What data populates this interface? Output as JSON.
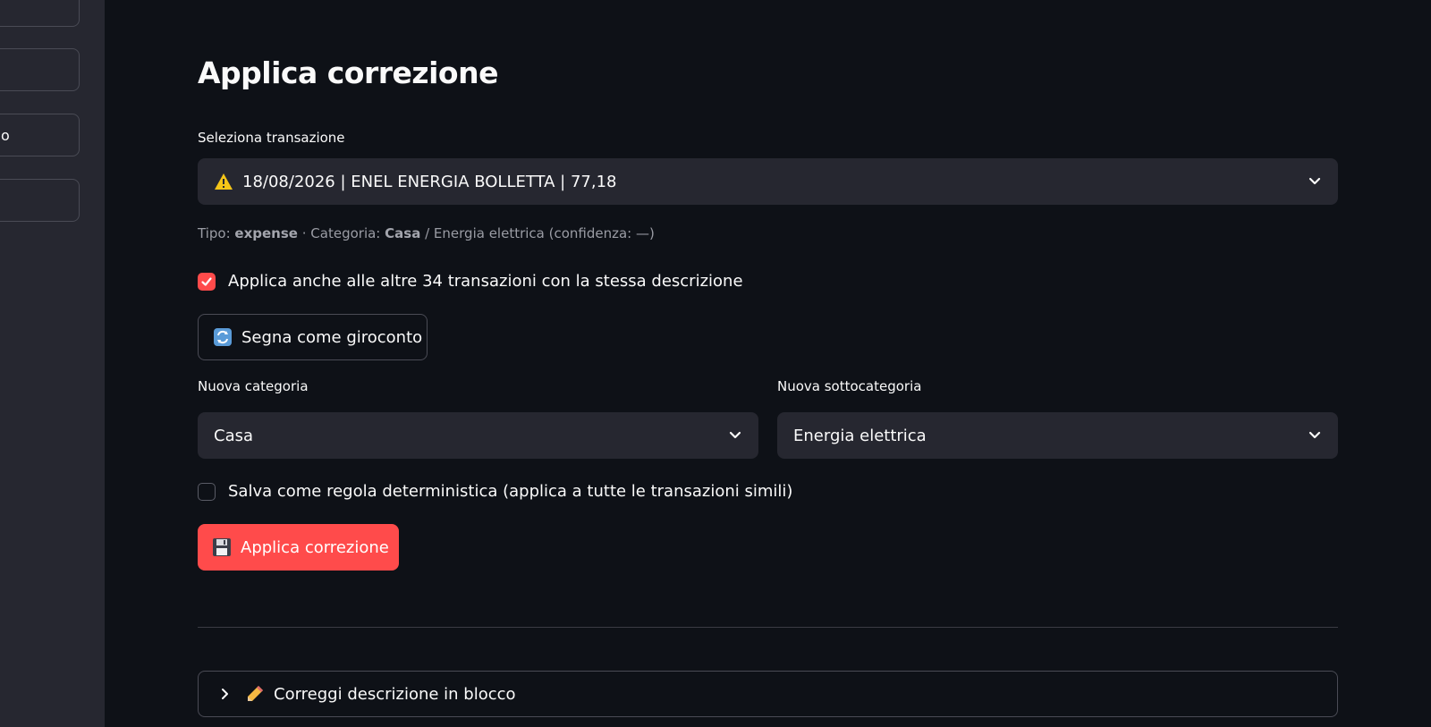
{
  "sidebar": {
    "buttons": [
      {
        "label": ""
      },
      {
        "label": ""
      },
      {
        "label": "o"
      },
      {
        "label": ""
      }
    ]
  },
  "page": {
    "title": "Applica correzione"
  },
  "transaction_select": {
    "label": "Seleziona transazione",
    "value": "18/08/2026 | ENEL ENERGIA BOLLETTA | 77,18",
    "icon": "warning-icon"
  },
  "caption": {
    "tipo_label": "Tipo:",
    "tipo_value": "expense",
    "separator": "·",
    "categoria_label": "Categoria:",
    "categoria_value": "Casa",
    "rest": "/ Energia elettrica (confidenza: —)"
  },
  "apply_all_checkbox": {
    "label": "Applica anche alle altre 34 transazioni con la stessa descrizione",
    "checked": true
  },
  "giroconto_button": {
    "label": "Segna come giroconto",
    "icon": "arrows-refresh-icon"
  },
  "category_select": {
    "label": "Nuova categoria",
    "value": "Casa"
  },
  "subcategory_select": {
    "label": "Nuova sottocategoria",
    "value": "Energia elettrica"
  },
  "rule_checkbox": {
    "label": "Salva come regola deterministica (applica a tutte le transazioni simili)",
    "checked": false
  },
  "apply_button": {
    "label": "Applica correzione",
    "icon": "floppy-disk-icon"
  },
  "expander": {
    "label": "Correggi descrizione in blocco",
    "icon": "pencil-icon"
  },
  "colors": {
    "background": "#0e1117",
    "sidebar": "#262730",
    "input": "#262730",
    "accent": "#ff4b4b"
  }
}
